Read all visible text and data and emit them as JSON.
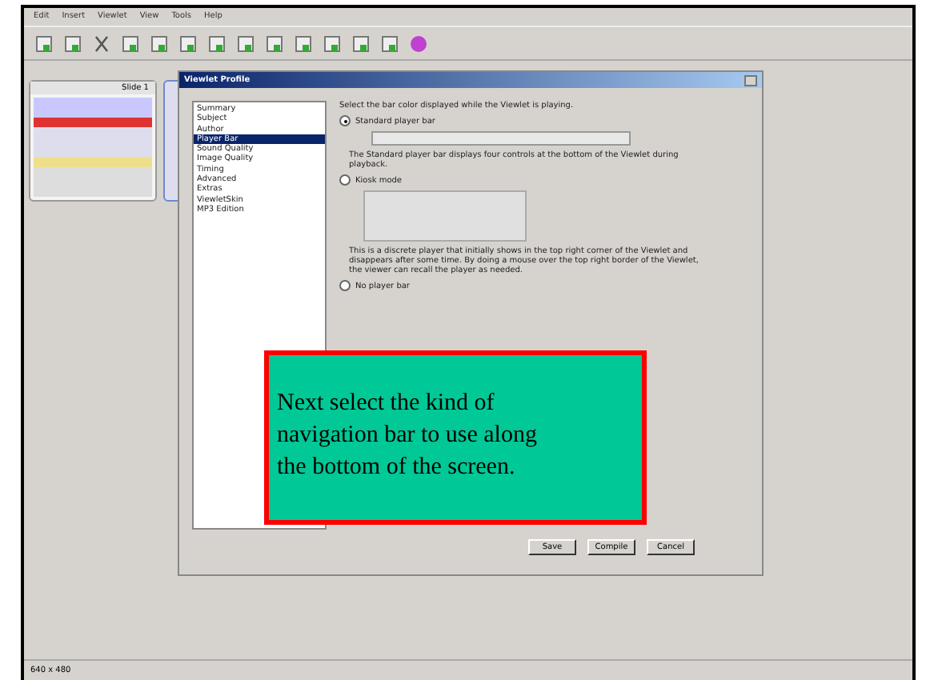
{
  "menu": [
    "Edit",
    "Insert",
    "Viewlet",
    "View",
    "Tools",
    "Help"
  ],
  "slides_panel": {
    "title": "Slide 1"
  },
  "dialog": {
    "title": "Viewlet Profile",
    "categories": [
      {
        "label": "Summary",
        "selected": false
      },
      {
        "label": "Subject",
        "selected": false
      },
      {
        "label": "Author",
        "selected": false
      },
      {
        "label": "Player Bar",
        "selected": true
      },
      {
        "label": "Sound Quality",
        "selected": false
      },
      {
        "label": "Image Quality",
        "selected": false
      },
      {
        "label": "Timing",
        "selected": false
      },
      {
        "label": "Advanced",
        "selected": false
      },
      {
        "label": "Extras",
        "selected": false
      },
      {
        "label": "ViewletSkin",
        "selected": false
      },
      {
        "label": "MP3 Edition",
        "selected": false
      }
    ],
    "intro": "Select the bar color displayed while the Viewlet is playing.",
    "options": [
      {
        "label": "Standard player bar",
        "selected": true,
        "kind": "standard",
        "description": "The Standard player bar displays four controls at the bottom of the Viewlet during playback."
      },
      {
        "label": "Kiosk mode",
        "selected": false,
        "kind": "kiosk",
        "description": "This is a discrete player that initially shows in the top right corner of the Viewlet and disappears after some time. By doing a mouse over the top right border of the Viewlet, the viewer can recall the player as needed."
      },
      {
        "label": "No player bar",
        "selected": false,
        "kind": "none"
      }
    ],
    "buttons": [
      "Save",
      "Compile",
      "Cancel"
    ]
  },
  "callout": "Next select the kind of navigation bar to use along the bottom of the screen.",
  "status_bar": {
    "dimensions": "640 x 480"
  }
}
